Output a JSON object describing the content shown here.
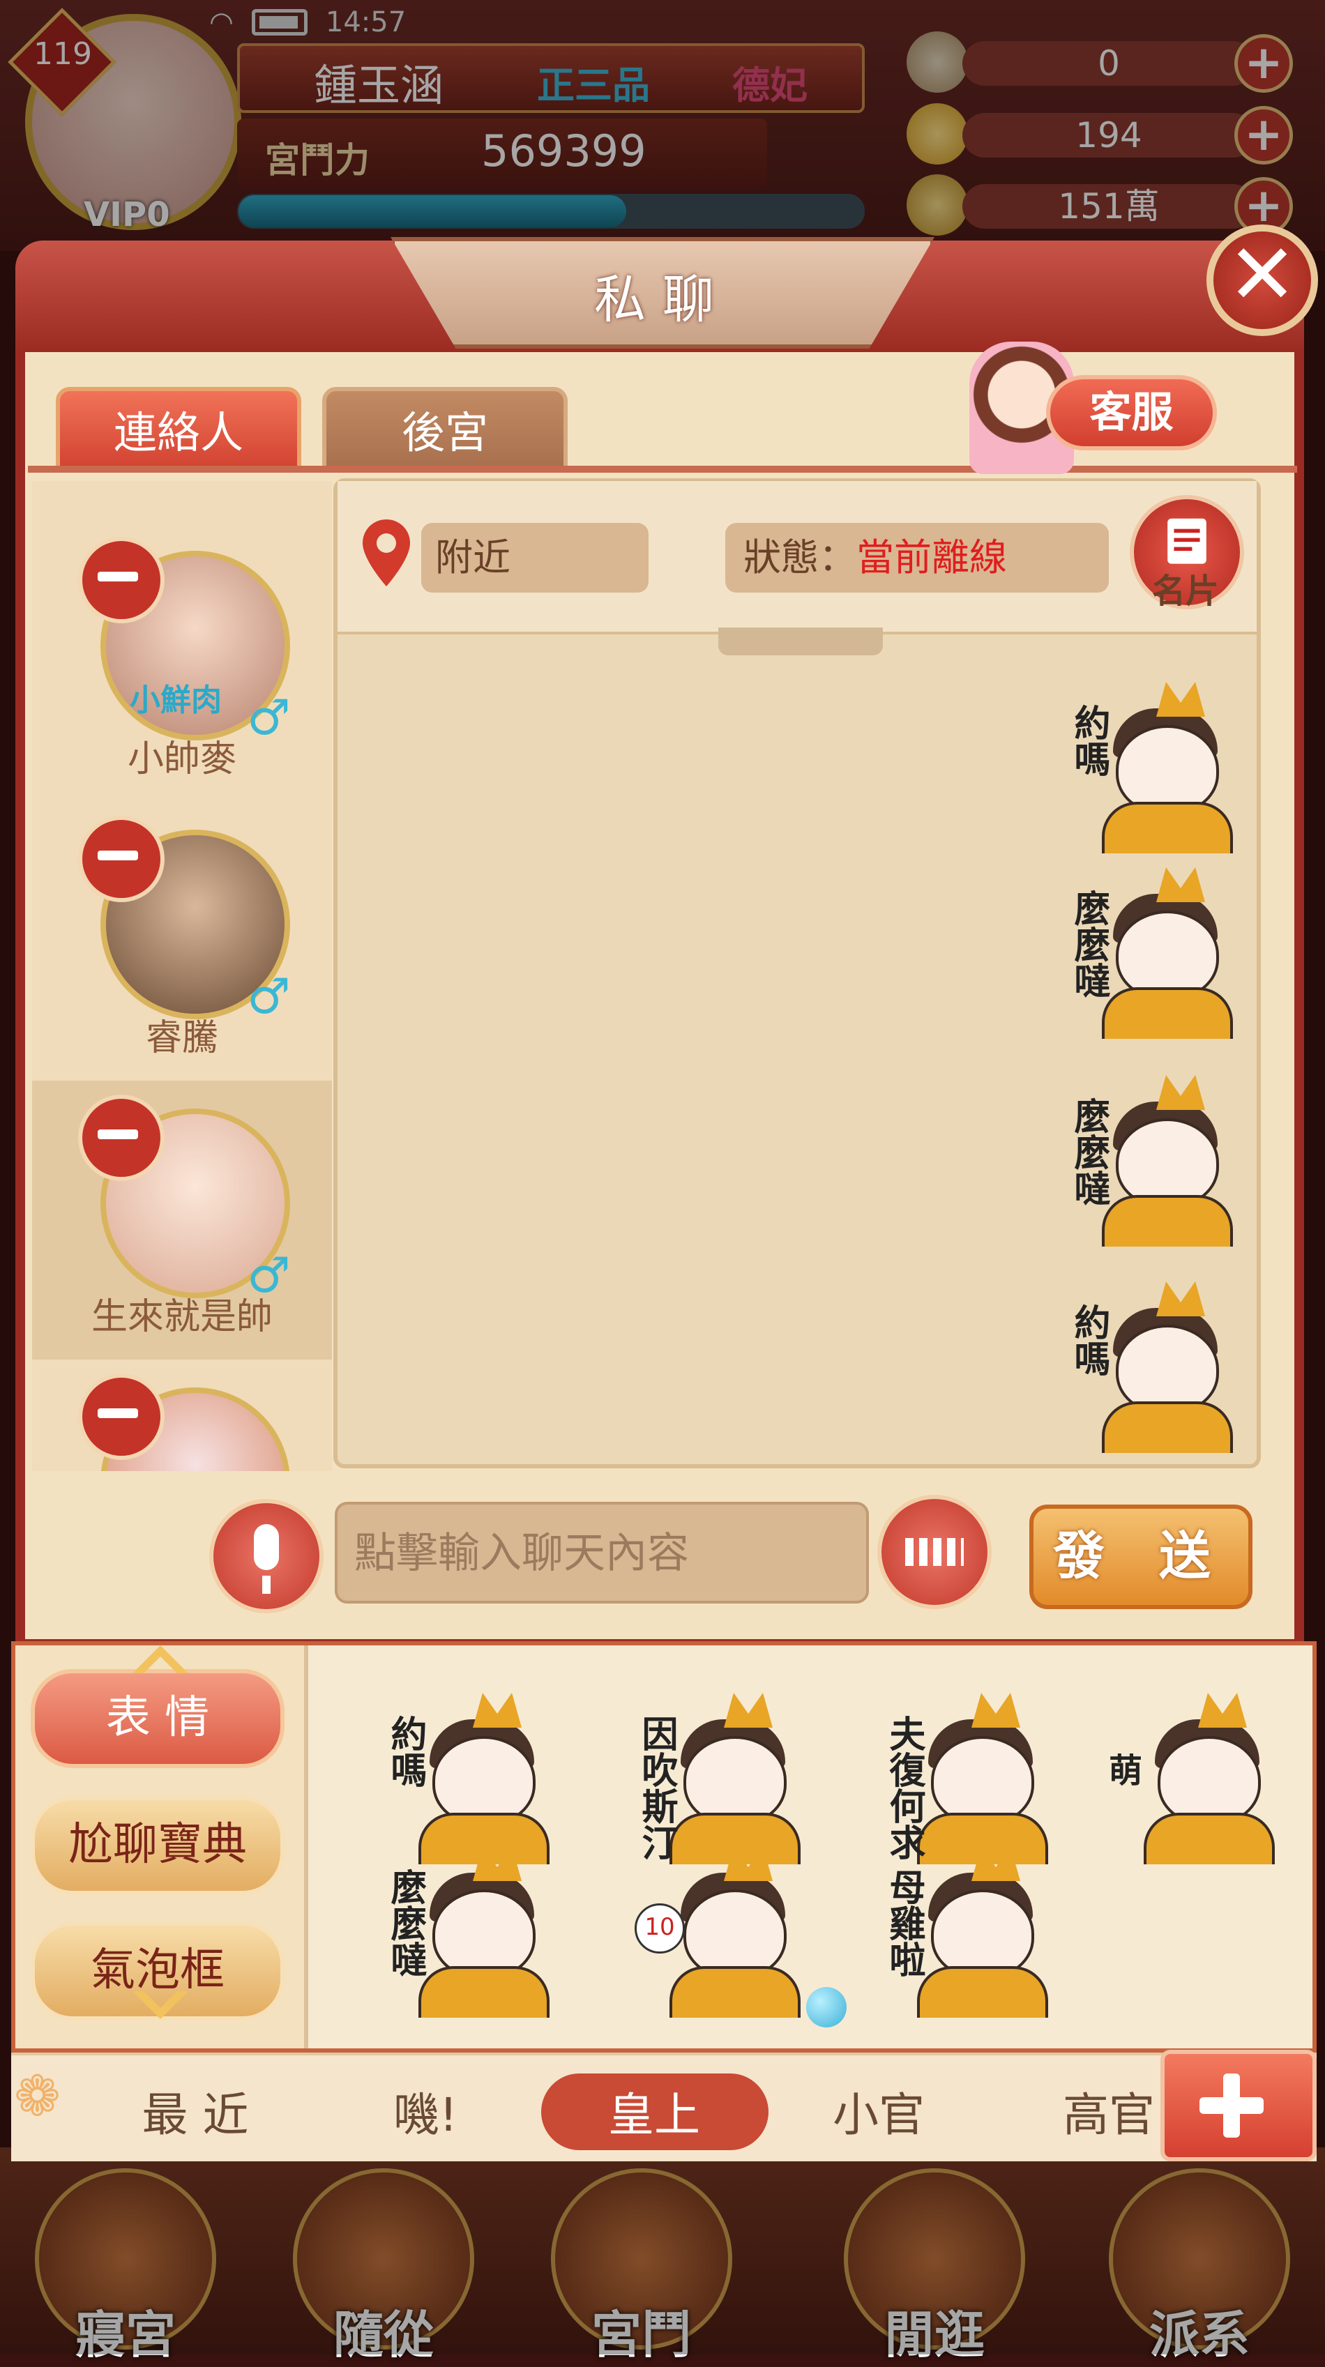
{
  "statusbar": {
    "time": "14:57"
  },
  "player": {
    "level": "119",
    "name": "鍾玉涵",
    "rank": "正三品",
    "consort": "德妃",
    "power_label": "宮鬥力",
    "power_value": "569399",
    "vip": "VIP0",
    "exp_fraction": 0.62
  },
  "resources": [
    {
      "icon": "currency-icon",
      "value": "0"
    },
    {
      "icon": "gold-ingot-icon",
      "value": "194"
    },
    {
      "icon": "coin-icon",
      "value": "151萬"
    }
  ],
  "dialog": {
    "title": "私聊"
  },
  "tabs": [
    {
      "label": "連絡人",
      "active": true
    },
    {
      "label": "後宮",
      "active": false
    }
  ],
  "service_button": "客服",
  "contacts": [
    {
      "name": "小帥麥",
      "gender": "♂",
      "tag": "小鮮肉"
    },
    {
      "name": "睿騰",
      "gender": "♂"
    },
    {
      "name": "生來就是帥",
      "gender": "♂",
      "selected": true
    },
    {
      "name": "",
      "gender": ""
    }
  ],
  "chat": {
    "location_label": "附近",
    "status_label": "狀態：",
    "status_value": "當前離線",
    "card_label": "名片",
    "messages": [
      {
        "sticker": "約嗎"
      },
      {
        "sticker": "麼麼噠"
      },
      {
        "sticker": "麼麼噠"
      },
      {
        "sticker": "約嗎"
      }
    ]
  },
  "input": {
    "placeholder": "點擊輸入聊天內容",
    "send_label": "發 送"
  },
  "drawer": {
    "side_buttons": [
      {
        "label": "表 情",
        "active": true
      },
      {
        "label": "尬聊寶典",
        "active": false
      },
      {
        "label": "氣泡框",
        "active": false
      }
    ],
    "stickers": [
      {
        "caption": "約嗎"
      },
      {
        "caption": "因吹斯汀"
      },
      {
        "caption": "夫復何求"
      },
      {
        "caption": "萌"
      },
      {
        "caption": "麼麼噠"
      },
      {
        "caption": "10"
      },
      {
        "caption": "母雞啦"
      }
    ],
    "categories": [
      {
        "label": "最 近",
        "active": false
      },
      {
        "label": "嘰!",
        "active": false
      },
      {
        "label": "皇上",
        "active": true
      },
      {
        "label": "小官",
        "active": false
      },
      {
        "label": "高官",
        "active": false
      }
    ]
  },
  "bottom_nav": [
    {
      "label": "寢宮"
    },
    {
      "label": "隨從"
    },
    {
      "label": "宮鬥"
    },
    {
      "label": "閒逛"
    },
    {
      "label": "派系"
    }
  ],
  "colors": {
    "frame_red": "#9b2b22",
    "accent_orange": "#e28b2a",
    "status_red": "#e01e1e",
    "parchment": "#f3e2c2"
  }
}
